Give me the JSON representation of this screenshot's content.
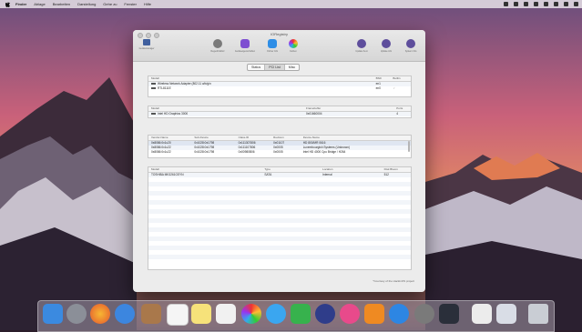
{
  "menubar": {
    "items": [
      "Finder",
      "Ablage",
      "Bearbeiten",
      "Darstellung",
      "Gehe zu",
      "Fenster",
      "Hilfe"
    ]
  },
  "window": {
    "title": "IORegistry",
    "toolbar": [
      {
        "label": "Gerätemanager",
        "icon": "device-icon"
      },
      {
        "label": "Regedit Editor",
        "icon": "regedit-icon"
      },
      {
        "label": "Geräteeigenschaften",
        "icon": "properties-icon"
      },
      {
        "label": "Ordner Info",
        "icon": "folder-icon"
      },
      {
        "label": "Farben",
        "icon": "colors-icon"
      },
      {
        "label": "Update Kext",
        "icon": "update-kext-icon"
      },
      {
        "label": "Update info",
        "icon": "update-info-icon"
      },
      {
        "label": "System Info",
        "icon": "system-info-icon"
      }
    ],
    "tabs": [
      "Status",
      "PCI List",
      "Misc"
    ],
    "selected_tab": "PCI List",
    "network": {
      "headers": [
        "Modell",
        "BSD",
        "Builtin"
      ],
      "rows": [
        {
          "name": "Wireless Network Adapter (802.11 a/b/g/n",
          "bsd": "en1",
          "builtin": ""
        },
        {
          "name": "RTL8111E",
          "bsd": "en0",
          "builtin": "✓"
        }
      ]
    },
    "graphics": {
      "headers": [
        "Modell",
        "Framebuffer",
        "Ports"
      ],
      "rows": [
        {
          "name": "Intel HD Graphics 3000",
          "framebuffer": "0x01660004",
          "ports": "4"
        }
      ]
    },
    "pci": {
      "headers": [
        "Vendor-Name",
        "Sub-Device",
        "Class-ID",
        "Revision",
        "Device-Name"
      ],
      "rows": [
        {
          "vendor": "0x8086:0x1c20",
          "sub": "0x1028:0x1798",
          "cls": "0x111307806",
          "rev": "0x01107",
          "dev": "HD 800/MR 0616"
        },
        {
          "vendor": "0x8086:0x1c22",
          "sub": "0x1028:0x1798",
          "cls": "0x111107806",
          "rev": "0x0005",
          "dev": "Luxembourgish Systems (Unknown)"
        },
        {
          "vendor": "0x8086:0x1c22",
          "sub": "0x1028:0x1798",
          "cls": "0x00980B06",
          "rev": "0x0005",
          "dev": "Intel HD 4000 Cpu Bridge / H264"
        }
      ]
    },
    "storage": {
      "headers": [
        "Modell",
        "Type",
        "Location",
        "Disk Bloom"
      ],
      "rows": [
        {
          "model": "TOSHIBA MK3261GSYN",
          "type": "SATA",
          "location": "Internal",
          "size": "512"
        }
      ]
    },
    "footer": "*Courtesy of the HackinOS project"
  },
  "dock": {
    "items": [
      "finder",
      "launchpad",
      "firefox",
      "safari",
      "notes-book",
      "calendar",
      "notes",
      "reminders",
      "photos",
      "messages",
      "facetime",
      "itunes-music",
      "ibooks",
      "app-store",
      "system-preferences",
      "activity-monitor",
      "textedit",
      "preview",
      "trash"
    ],
    "colors": {
      "finder": "#2f8bd8",
      "firefox": "#e66a1f",
      "safari": "#3a8ee0",
      "photos": "#e3464d",
      "messages": "#3fc55a",
      "itunes": "#e84a8b",
      "ibooks": "#ef8a22",
      "appstore": "#2d86e3"
    }
  }
}
